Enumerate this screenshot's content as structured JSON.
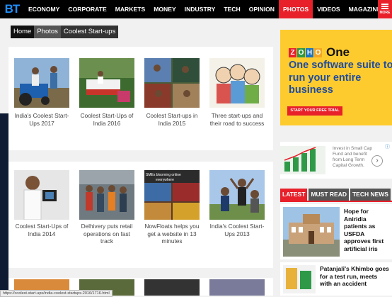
{
  "logo": "BT",
  "nav": {
    "items": [
      "ECONOMY",
      "CORPORATE",
      "MARKETS",
      "MONEY",
      "INDUSTRY",
      "TECH",
      "OPINION",
      "PHOTOS",
      "VIDEOS",
      "MAGAZINE"
    ],
    "active": "PHOTOS",
    "more_label": "MORE"
  },
  "breadcrumb": [
    "Home",
    "Photos",
    "Coolest Start-ups"
  ],
  "gallery_row1": [
    {
      "caption": "India's Coolest Start-Ups 2017"
    },
    {
      "caption": "Coolest Start-Ups of India 2016"
    },
    {
      "caption": "Coolest Start-ups in India 2015"
    },
    {
      "caption": "Three start-ups and their road to success"
    }
  ],
  "gallery_row2": [
    {
      "caption": "Coolest Start-Ups of India 2014"
    },
    {
      "caption": "Delhivery puts retail operations on fast track"
    },
    {
      "caption": "NowFloats helps you get a website in 13 minutes",
      "image_text": "SMEs blooming online everywhere"
    },
    {
      "caption": "India's Coolest Start-Ups 2013"
    }
  ],
  "ad_zoho": {
    "logo_letters": [
      "Z",
      "O",
      "H",
      "O"
    ],
    "logo_colors": [
      "#e8202a",
      "#2e9a47",
      "#1e73be",
      "#f5a623"
    ],
    "product": "One",
    "headline": "One software suite to run your entire business",
    "cta": "START YOUR FREE TRIAL"
  },
  "ad_fund": {
    "text": "Invest in Small Cap Fund and benefit from Long Term Capital Growth.",
    "arrow": "›",
    "info": "ⓘ"
  },
  "tabs": [
    "LATEST",
    "MUST READ",
    "TECH NEWS"
  ],
  "news": [
    {
      "title": "Hope for Aniridia patients as USFDA approves first artificial iris"
    },
    {
      "title": "Patanjali's Khimbo goes for a test run, meets with an accident"
    }
  ],
  "status_url": "https://coolest-start-ups/india-coolest-startups-2016/1716.html",
  "colors": {
    "brand_red": "#e8202a",
    "ad_yellow": "#fecb2f",
    "ad_blue": "#1e4b9f"
  }
}
